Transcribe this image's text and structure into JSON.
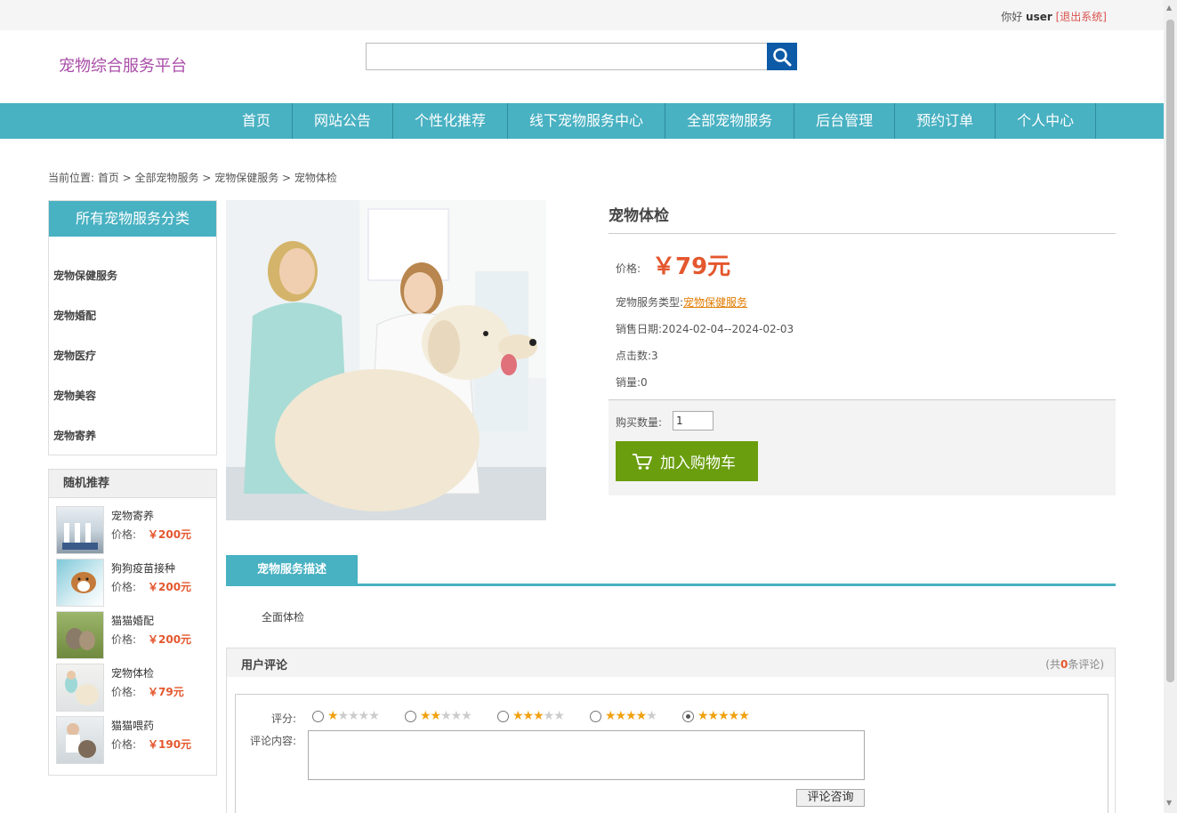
{
  "topbar": {
    "greeting": "你好",
    "username": "user",
    "logout": "[退出系统]"
  },
  "logo": "宠物综合服务平台",
  "search": {
    "value": ""
  },
  "nav": [
    "首页",
    "网站公告",
    "个性化推荐",
    "线下宠物服务中心",
    "全部宠物服务",
    "后台管理",
    "预约订单",
    "个人中心"
  ],
  "breadcrumb": "当前位置: 首页 > 全部宠物服务 > 宠物保健服务 > 宠物体检",
  "categories": {
    "title": "所有宠物服务分类",
    "items": [
      "宠物保健服务",
      "宠物婚配",
      "宠物医疗",
      "宠物美容",
      "宠物寄养"
    ]
  },
  "recommend": {
    "title": "随机推荐",
    "price_label": "价格:",
    "items": [
      {
        "name": "宠物寄养",
        "price": "￥200元"
      },
      {
        "name": "狗狗疫苗接种",
        "price": "￥200元"
      },
      {
        "name": "猫猫婚配",
        "price": "￥200元"
      },
      {
        "name": "宠物体检",
        "price": "￥79元"
      },
      {
        "name": "猫猫喂药",
        "price": "￥190元"
      }
    ]
  },
  "product": {
    "title": "宠物体检",
    "price_label": "价格:",
    "price": "￥79元",
    "type_label": "宠物服务类型:",
    "type_value": "宠物保健服务",
    "date_label": "销售日期:",
    "date_value": "2024-02-04--2024-02-03",
    "clicks_label": "点击数:",
    "clicks_value": "3",
    "sales_label": "销量:",
    "sales_value": "0",
    "qty_label": "购买数量:",
    "qty_value": "1",
    "cart_button": "加入购物车"
  },
  "tab": {
    "label": "宠物服务描述",
    "content": "全面体检"
  },
  "comments": {
    "title": "用户评论",
    "count_prefix": "(共",
    "count": "0",
    "count_suffix": "条评论)",
    "rating_label": "评分:",
    "rating_selected": 5,
    "content_label": "评论内容:",
    "submit": "评论咨询"
  },
  "colors": {
    "accent": "#48b1c2",
    "price": "#e4572e",
    "cart": "#6a9e0e",
    "logo": "#a94ea8"
  }
}
